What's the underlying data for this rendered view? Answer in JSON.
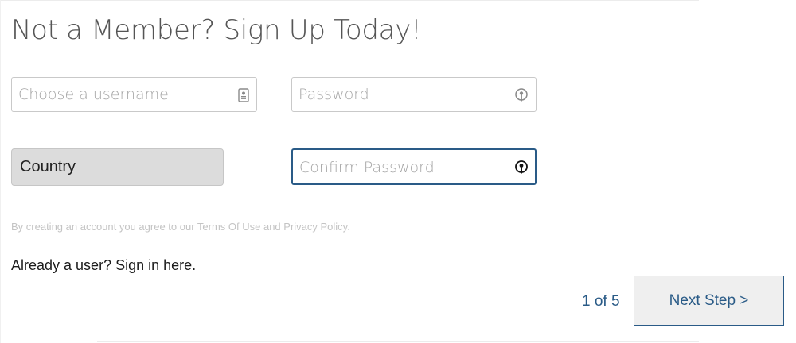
{
  "page": {
    "title": "Not a Member? Sign Up Today!"
  },
  "form": {
    "username": {
      "placeholder": "Choose a username",
      "value": "",
      "icon": "id-card-icon"
    },
    "password": {
      "placeholder": "Password",
      "value": "",
      "icon": "key-lock-icon"
    },
    "country": {
      "selected": "Country"
    },
    "confirm_password": {
      "placeholder": "Confirm Password",
      "value": "",
      "icon": "key-lock-icon",
      "focused": true
    }
  },
  "footer": {
    "terms_text": "By creating an account you agree to our Terms Of Use and Privacy Policy.",
    "signin_link": "Already a user? Sign in here."
  },
  "pagination": {
    "step_text": "1 of 5",
    "next_label": "Next Step >"
  },
  "colors": {
    "accent": "#2a5b87",
    "select_bg": "#dcdcdc",
    "title_text": "#555555",
    "muted_text": "#c4c4c4"
  }
}
